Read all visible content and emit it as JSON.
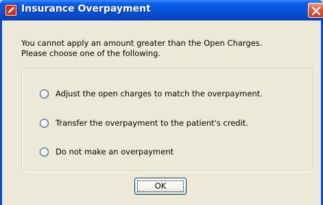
{
  "dialog": {
    "title": "Insurance Overpayment",
    "message_line1": "You cannot apply an amount greater than the Open Charges.",
    "message_line2": "Please choose one of the following.",
    "options": [
      "Adjust the open charges to match the overpayment.",
      "Transfer the overpayment to the patient's credit.",
      "Do not make an overpayment"
    ],
    "ok_label": "OK",
    "title_icon": "app-pencil-icon",
    "close_icon": "close-icon"
  },
  "colors": {
    "titlebar": "#0852d8",
    "client_bg": "#ece9d8",
    "close_button": "#e05a3a"
  }
}
